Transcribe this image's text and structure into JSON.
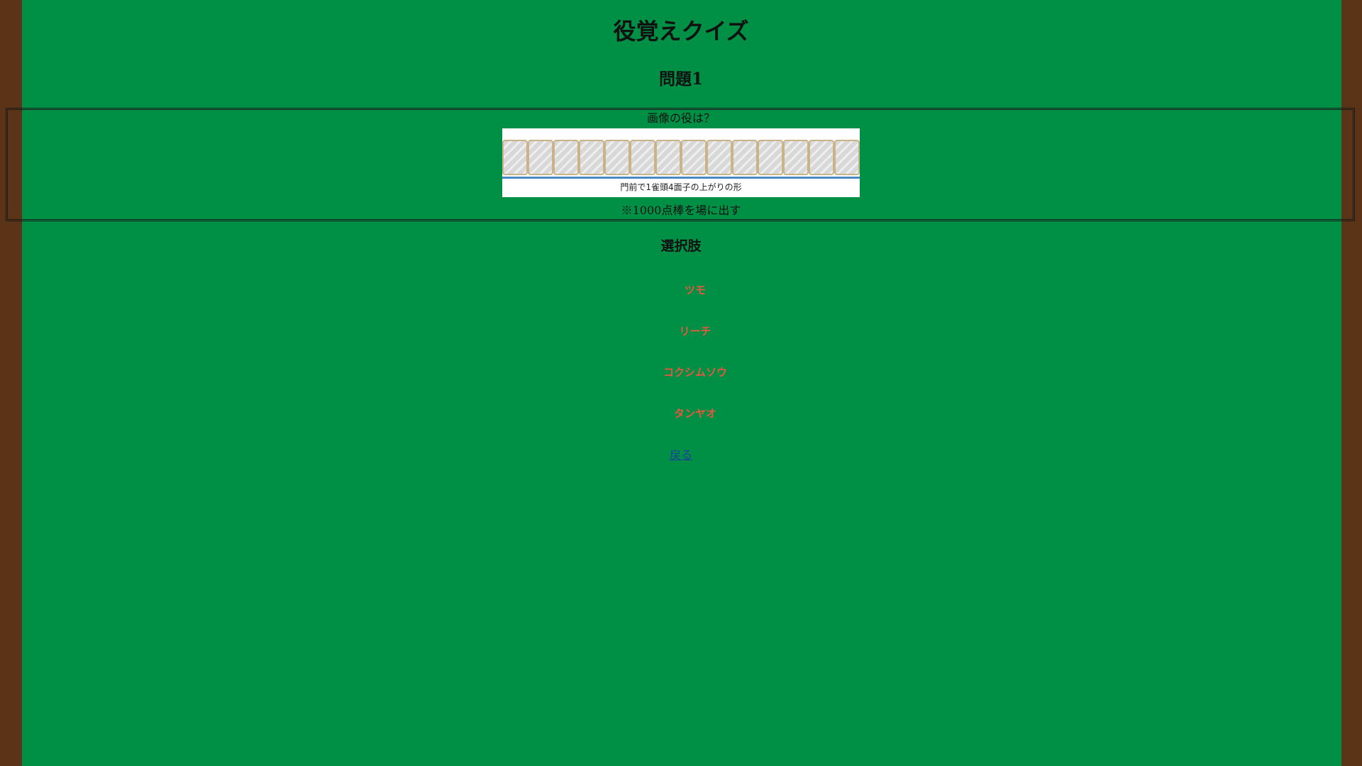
{
  "page": {
    "title": "役覚えクイズ"
  },
  "question": {
    "heading": "問題1",
    "prompt": "画像の役は？",
    "hand_caption": "門前で1雀頭4面子の上がりの形",
    "note": "※1000点棒を場に出す",
    "tile_count": 14
  },
  "choices": {
    "heading": "選択肢",
    "items": [
      {
        "label": "ツモ"
      },
      {
        "label": "リーチ"
      },
      {
        "label": "コクシムソウ"
      },
      {
        "label": "タンヤオ"
      }
    ]
  },
  "nav": {
    "back_label": "戻る"
  },
  "colors": {
    "felt": "#009045",
    "frame": "#5b3417",
    "choice_text": "#e8573e",
    "link": "#1d3f9c"
  }
}
